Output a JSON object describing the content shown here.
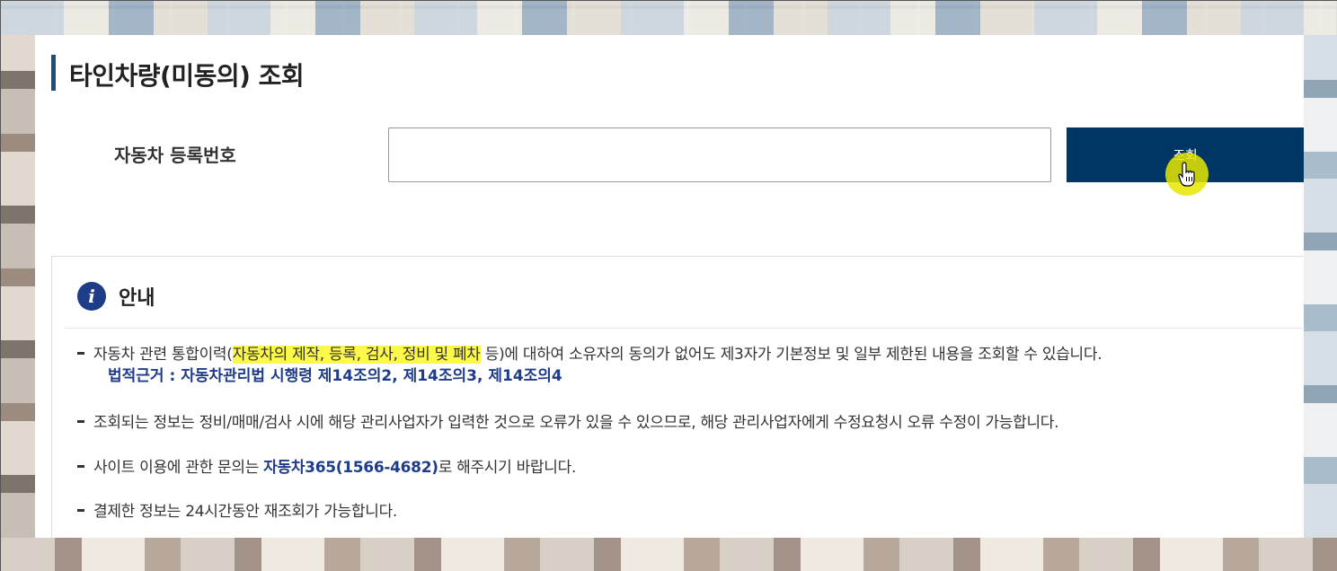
{
  "page": {
    "title": "타인차량(미동의) 조회"
  },
  "search": {
    "label": "자동차 등록번호",
    "input_value": "",
    "button_label": "조회"
  },
  "info": {
    "title": "안내",
    "icon": "info-icon",
    "notices": [
      {
        "prefix": "자동차 관련 통합이력(",
        "highlight": "자동차의 제작, 등록, 검사, 정비 및 폐차",
        "suffix": " 등)에 대하여 소유자의 동의가 없어도 제3자가 기본정보 및 일부 제한된 내용을 조회할 수 있습니다.",
        "legal_basis": "법적근거 : 자동차관리법 시행령 제14조의2, 제14조의3, 제14조의4"
      },
      {
        "text": "조회되는 정보는 정비/매매/검사 시에 해당 관리사업자가 입력한 것으로 오류가 있을 수 있으므로, 해당 관리사업자에게 수정요청시 오류 수정이 가능합니다."
      },
      {
        "prefix": "사이트 이용에 관한 문의는 ",
        "emphasis": "자동차365(1566-4682)",
        "suffix": "로 해주시기 바랍니다."
      },
      {
        "text": "결제한 정보는 24시간동안 재조회가 가능합니다."
      }
    ]
  },
  "colors": {
    "accent": "#003663",
    "info_blue": "#1f3c88",
    "highlight": "#fdf94a",
    "cursor_highlight": "#e6e600"
  }
}
